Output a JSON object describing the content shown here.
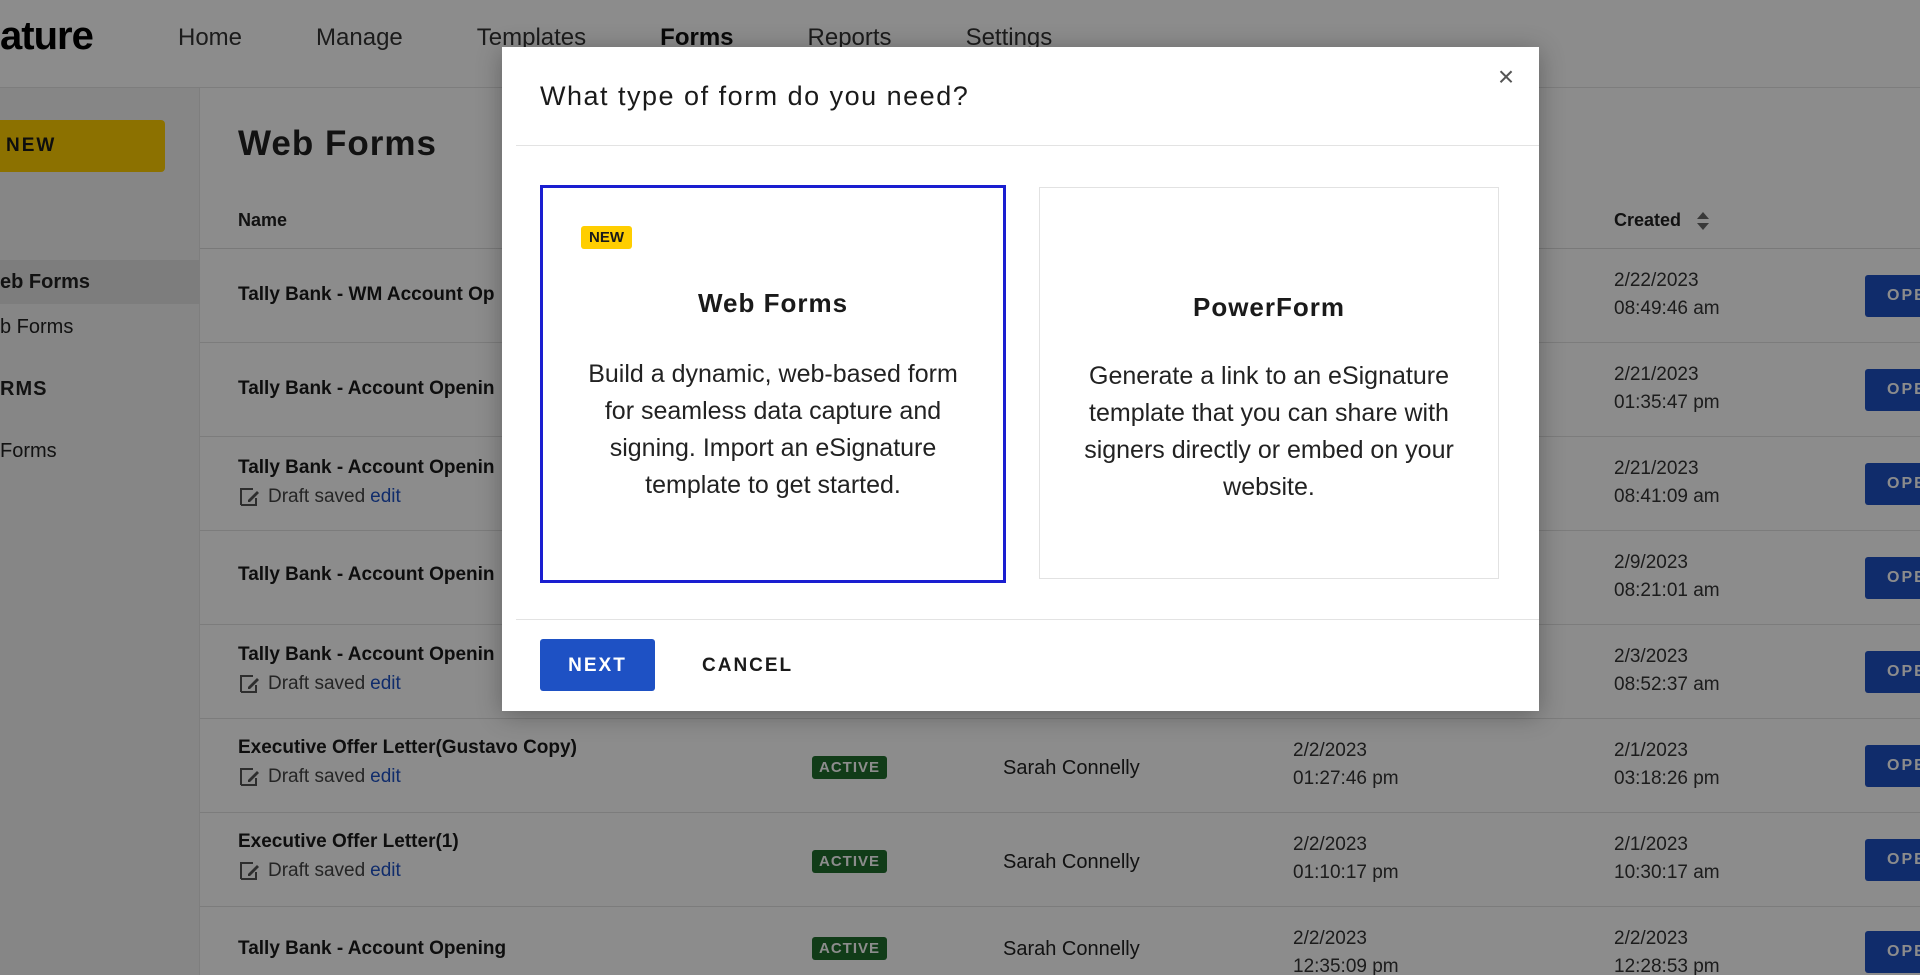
{
  "app": {
    "logo_text": "ature"
  },
  "nav": {
    "items": [
      {
        "label": "Home",
        "active": false
      },
      {
        "label": "Manage",
        "active": false
      },
      {
        "label": "Templates",
        "active": false
      },
      {
        "label": "Forms",
        "active": true
      },
      {
        "label": "Reports",
        "active": false
      },
      {
        "label": "Settings",
        "active": false
      }
    ]
  },
  "sidebar": {
    "new_label": "NEW",
    "items": [
      {
        "label": "eb Forms"
      },
      {
        "label": "b Forms"
      },
      {
        "label": "RMS"
      },
      {
        "label": "Forms"
      }
    ]
  },
  "main": {
    "title": "Web Forms",
    "columns": {
      "name": "Name",
      "created": "Created"
    },
    "draft_text": "Draft saved",
    "edit_text": "edit",
    "active_badge": "ACTIVE",
    "open_label": "OPE",
    "rows": [
      {
        "name": "Tally Bank - WM Account Op",
        "draft": false,
        "created_date": "2/22/2023",
        "created_time": "08:49:46 am"
      },
      {
        "name": "Tally Bank - Account Openin",
        "draft": false,
        "created_date": "2/21/2023",
        "created_time": "01:35:47 pm"
      },
      {
        "name": "Tally Bank - Account Openin",
        "draft": true,
        "created_date": "2/21/2023",
        "created_time": "08:41:09 am"
      },
      {
        "name": "Tally Bank - Account Openin",
        "draft": false,
        "created_date": "2/9/2023",
        "created_time": "08:21:01 am"
      },
      {
        "name": "Tally Bank - Account Openin",
        "draft": true,
        "created_date": "2/3/2023",
        "created_time": "08:52:37 am"
      },
      {
        "name": "Executive Offer Letter(Gustavo Copy)",
        "draft": true,
        "status": "ACTIVE",
        "owner": "Sarah Connelly",
        "modified_date": "2/2/2023",
        "modified_time": "01:27:46 pm",
        "created_date": "2/1/2023",
        "created_time": "03:18:26 pm"
      },
      {
        "name": "Executive Offer Letter(1)",
        "draft": true,
        "status": "ACTIVE",
        "owner": "Sarah Connelly",
        "modified_date": "2/2/2023",
        "modified_time": "01:10:17 pm",
        "created_date": "2/1/2023",
        "created_time": "10:30:17 am"
      },
      {
        "name": "Tally Bank - Account Opening",
        "draft": false,
        "status": "ACTIVE",
        "owner": "Sarah Connelly",
        "modified_date": "2/2/2023",
        "modified_time": "12:35:09 pm",
        "created_date": "2/2/2023",
        "created_time": "12:28:53 pm"
      }
    ]
  },
  "modal": {
    "title": "What type of form do you need?",
    "close_glyph": "×",
    "options": [
      {
        "badge": "NEW",
        "title": "Web Forms",
        "description": "Build a dynamic, web-based form for seamless data capture and signing. Import an eSignature template to get started.",
        "selected": true
      },
      {
        "title": "PowerForm",
        "description": "Generate a link to an eSignature template that you can share with signers directly or embed on your website.",
        "selected": false
      }
    ],
    "next_label": "NEXT",
    "cancel_label": "CANCEL"
  },
  "colors": {
    "brand_yellow": "#ffce00",
    "primary_blue": "#1e51c4",
    "selected_border": "#1a1ed0",
    "active_green": "#1f6e2c"
  }
}
